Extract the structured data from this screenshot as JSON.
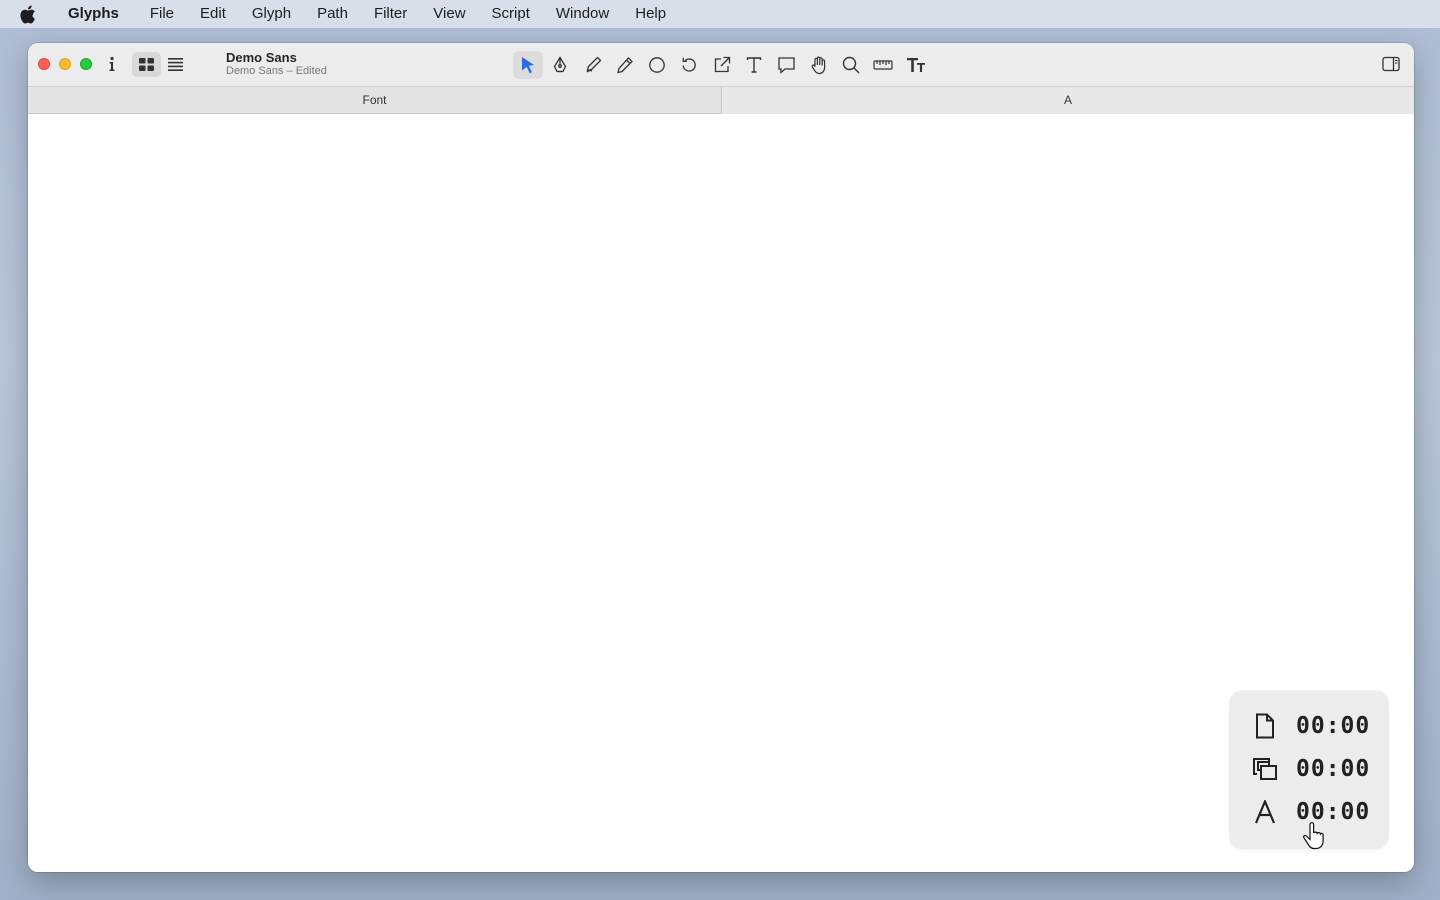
{
  "menubar": {
    "apple_icon": "apple-logo-icon",
    "items": [
      "Glyphs",
      "File",
      "Edit",
      "Glyph",
      "Path",
      "Filter",
      "View",
      "Script",
      "Window",
      "Help"
    ]
  },
  "window": {
    "document": {
      "name": "Demo Sans",
      "subtitle": "Demo Sans – Edited"
    },
    "view_modes": [
      "grid-view-icon",
      "list-view-icon"
    ],
    "tools": [
      "select-tool-icon",
      "pen-tool-icon",
      "draw-tool-icon",
      "pencil-tool-icon",
      "ellipse-tool-icon",
      "rotate-tool-icon",
      "export-tool-icon",
      "text-tool-icon",
      "annotation-tool-icon",
      "hand-tool-icon",
      "zoom-tool-icon",
      "measure-tool-icon",
      "font-size-icon"
    ],
    "active_tool": "select-tool-icon",
    "tabs": {
      "font": "Font",
      "glyph": "A"
    }
  },
  "hud": {
    "rows": [
      {
        "icon": "document-icon",
        "time": "00:00"
      },
      {
        "icon": "layers-icon",
        "time": "00:00"
      },
      {
        "icon": "glyph-a-icon",
        "time": "00:00"
      }
    ]
  },
  "colors": {
    "accent": "#2d6cdf",
    "close": "#fe5f57",
    "minimize": "#febc2e",
    "maximize": "#28c840"
  }
}
